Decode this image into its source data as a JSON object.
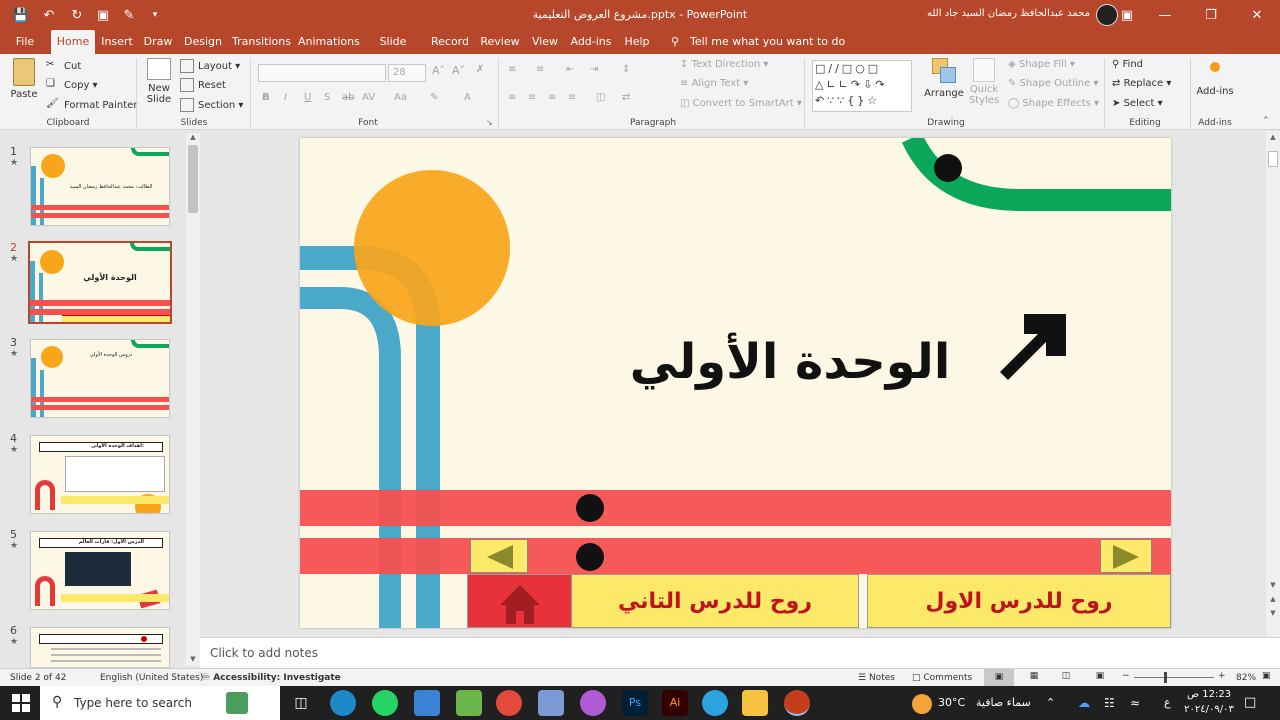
{
  "window": {
    "title": "مشروع العروض التعليمية.pptx  -  PowerPoint",
    "user_name": "محمد عبدالحافظ رمضان السيد جاد الله"
  },
  "tabs": [
    "File",
    "Home",
    "Insert",
    "Draw",
    "Design",
    "Transitions",
    "Animations",
    "Slide Show",
    "Record",
    "Review",
    "View",
    "Add-ins",
    "Help"
  ],
  "tell_me": "Tell me what you want to do",
  "ribbon": {
    "clipboard": {
      "paste": "Paste",
      "cut": "Cut",
      "copy": "Copy",
      "format_painter": "Format Painter",
      "label": "Clipboard"
    },
    "slides": {
      "new_slide": "New Slide",
      "layout": "Layout",
      "reset": "Reset",
      "section": "Section",
      "label": "Slides"
    },
    "font": {
      "size": "28",
      "label": "Font"
    },
    "paragraph": {
      "text_direction": "Text Direction",
      "align_text": "Align Text",
      "convert_smartart": "Convert to SmartArt",
      "label": "Paragraph"
    },
    "drawing": {
      "arrange": "Arrange",
      "quick_styles": "Quick Styles",
      "shape_fill": "Shape Fill",
      "shape_outline": "Shape Outline",
      "shape_effects": "Shape Effects",
      "label": "Drawing"
    },
    "editing": {
      "find": "Find",
      "replace": "Replace",
      "select": "Select",
      "label": "Editing"
    },
    "addins": {
      "addins": "Add-ins",
      "label": "Add-ins"
    }
  },
  "thumbnails": [
    {
      "num": "1",
      "title": "الطالب: محمد عبدالحافظ رمضان السيد"
    },
    {
      "num": "2",
      "title": "الوحدة الأولي"
    },
    {
      "num": "3",
      "title": "دروس الوحدة الأولي"
    },
    {
      "num": "4",
      "title": "اهداف الوحدة الأولى:"
    },
    {
      "num": "5",
      "title": "الدرس الأول: قارات العالم"
    },
    {
      "num": "6",
      "title": ""
    }
  ],
  "slide": {
    "title": "الوحدة الأولي",
    "btn_lesson1": "روح للدرس الاول",
    "btn_lesson2": "روح للدرس التاني"
  },
  "notes_placeholder": "Click to add notes",
  "status": {
    "slide_info": "Slide 2 of 42",
    "language": "English (United States)",
    "accessibility": "Accessibility: Investigate",
    "notes": "Notes",
    "comments": "Comments",
    "zoom": "82%"
  },
  "taskbar": {
    "search_placeholder": "Type here to search",
    "weather_temp": "30°C",
    "weather_text": "سماء صافية",
    "lang": "ع",
    "time": "12:23 ص",
    "date": "٢٠٢٤/٠٩/٠٣"
  },
  "colors": {
    "accent": "#b7472a",
    "slide_bg": "#fdf8e6",
    "red_band": "#f45050",
    "yellow": "#fce96a",
    "blue": "#4aa8c9",
    "orange": "#f9a51a",
    "green": "#0aa858"
  }
}
